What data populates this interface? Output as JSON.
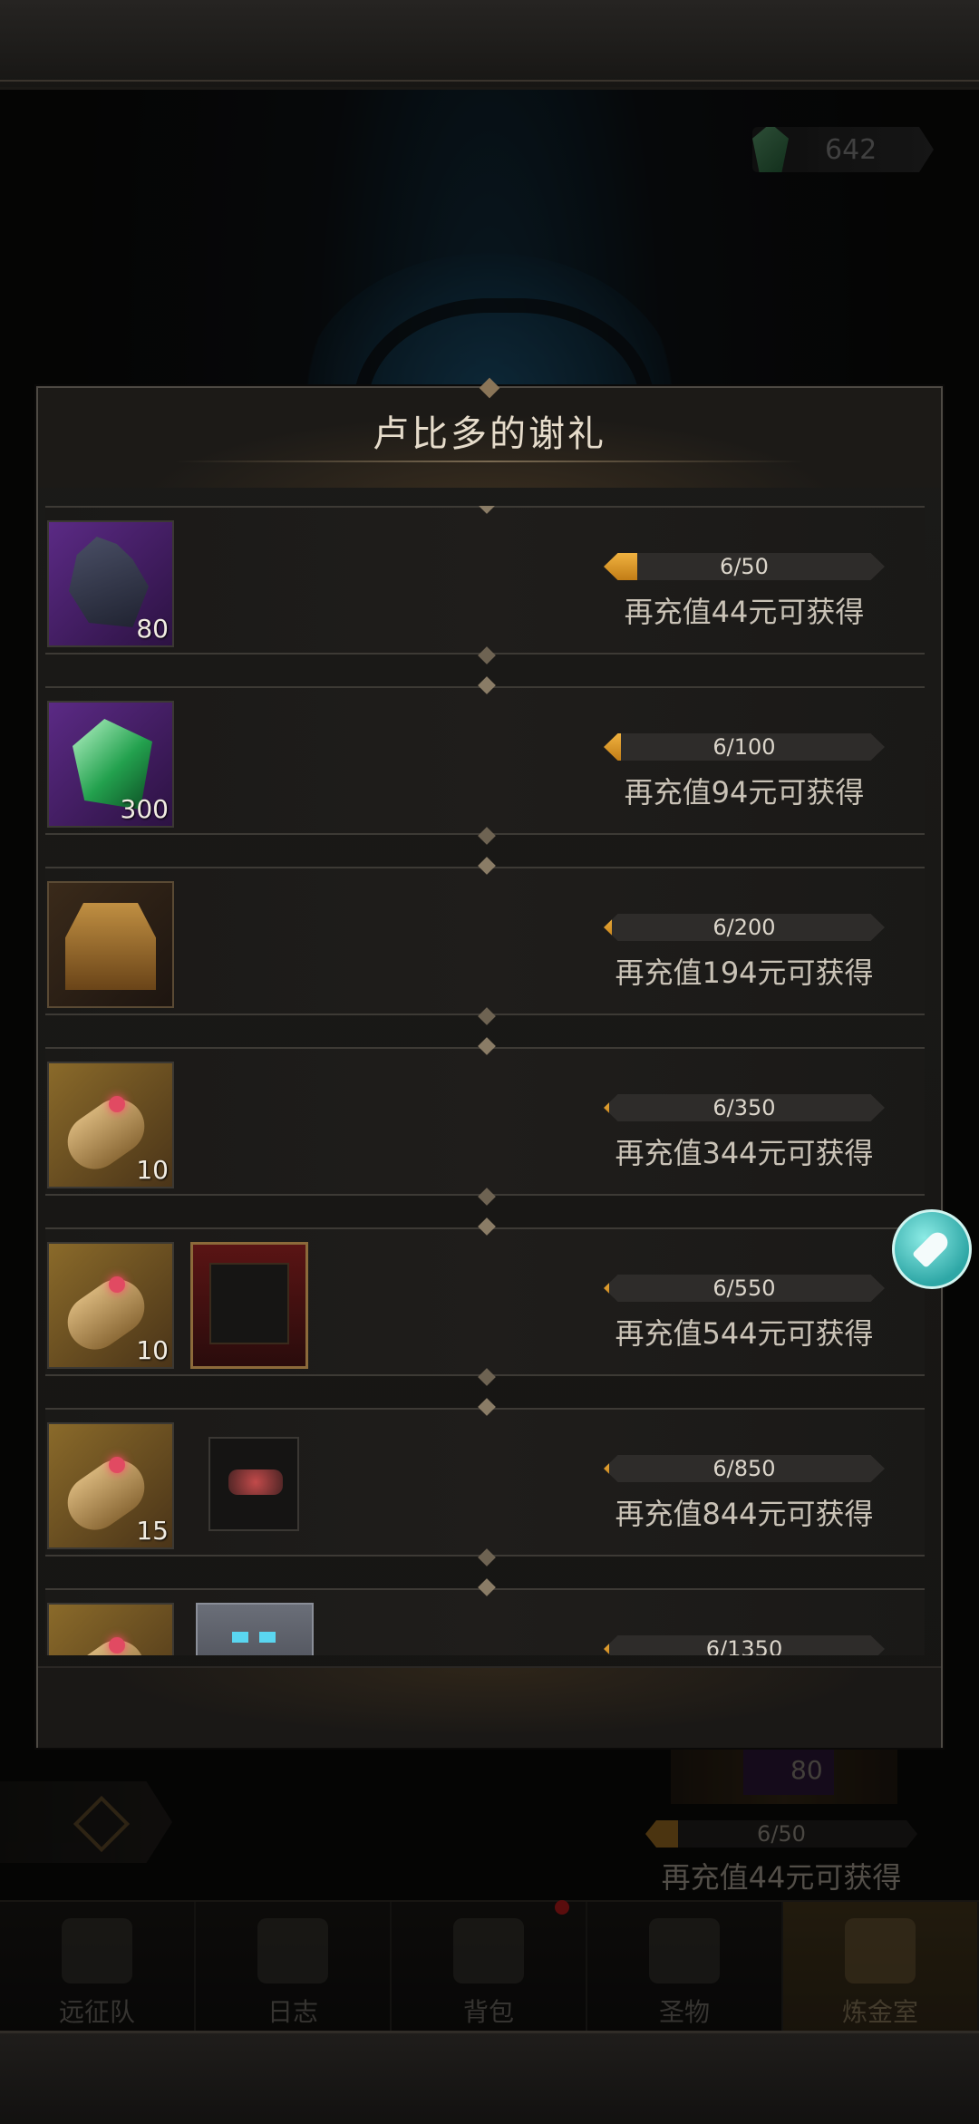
{
  "currency": {
    "gem_value": "642",
    "icon": "emerald-gem-icon"
  },
  "dialog": {
    "title": "卢比多的谢礼",
    "rows": [
      {
        "items": [
          {
            "icon": "dark-ore-icon",
            "count": "80",
            "bg": "purple"
          }
        ],
        "progress_text": "6/50",
        "progress": 0.12,
        "recharge_text": "再充值44元可获得"
      },
      {
        "items": [
          {
            "icon": "emerald-gem-icon",
            "count": "300",
            "bg": "purple"
          }
        ],
        "progress_text": "6/100",
        "progress": 0.06,
        "recharge_text": "再充值94元可获得"
      },
      {
        "items": [
          {
            "icon": "treasure-chest-icon",
            "count": "",
            "bg": "dark"
          }
        ],
        "progress_text": "6/200",
        "progress": 0.03,
        "recharge_text": "再充值194元可获得"
      },
      {
        "items": [
          {
            "icon": "summon-scroll-icon",
            "count": "10",
            "bg": "gold"
          }
        ],
        "progress_text": "6/350",
        "progress": 0.017,
        "recharge_text": "再充值344元可获得"
      },
      {
        "items": [
          {
            "icon": "summon-scroll-icon",
            "count": "10",
            "bg": "gold"
          },
          {
            "icon": "avatar-frame-icon",
            "count": ""
          }
        ],
        "progress_text": "6/550",
        "progress": 0.011,
        "recharge_text": "再充值544元可获得"
      },
      {
        "items": [
          {
            "icon": "summon-scroll-icon",
            "count": "15",
            "bg": "gold"
          },
          {
            "icon": "skull-emblem-icon",
            "count": ""
          }
        ],
        "progress_text": "6/850",
        "progress": 0.007,
        "recharge_text": "再充值844元可获得"
      },
      {
        "items": [
          {
            "icon": "summon-scroll-icon",
            "count": "",
            "bg": "gold"
          },
          {
            "icon": "demon-portrait-icon",
            "count": ""
          }
        ],
        "progress_text": "6/1350",
        "progress": 0.004,
        "recharge_text": ""
      }
    ]
  },
  "background": {
    "item_count": "80",
    "progress_text": "6/50",
    "progress": 0.12,
    "recharge_text": "再充值44元可获得"
  },
  "bottom_nav": [
    {
      "label": "远征队",
      "icon": "helmet-icon"
    },
    {
      "label": "日志",
      "icon": "journal-icon"
    },
    {
      "label": "背包",
      "icon": "backpack-icon"
    },
    {
      "label": "圣物",
      "icon": "torch-icon"
    },
    {
      "label": "炼金室",
      "icon": "alchemy-icon",
      "active": true
    }
  ],
  "colors": {
    "progress_fill": "#d3922a",
    "accent": "#e6dccb",
    "rocket": "#3ab5b0"
  }
}
